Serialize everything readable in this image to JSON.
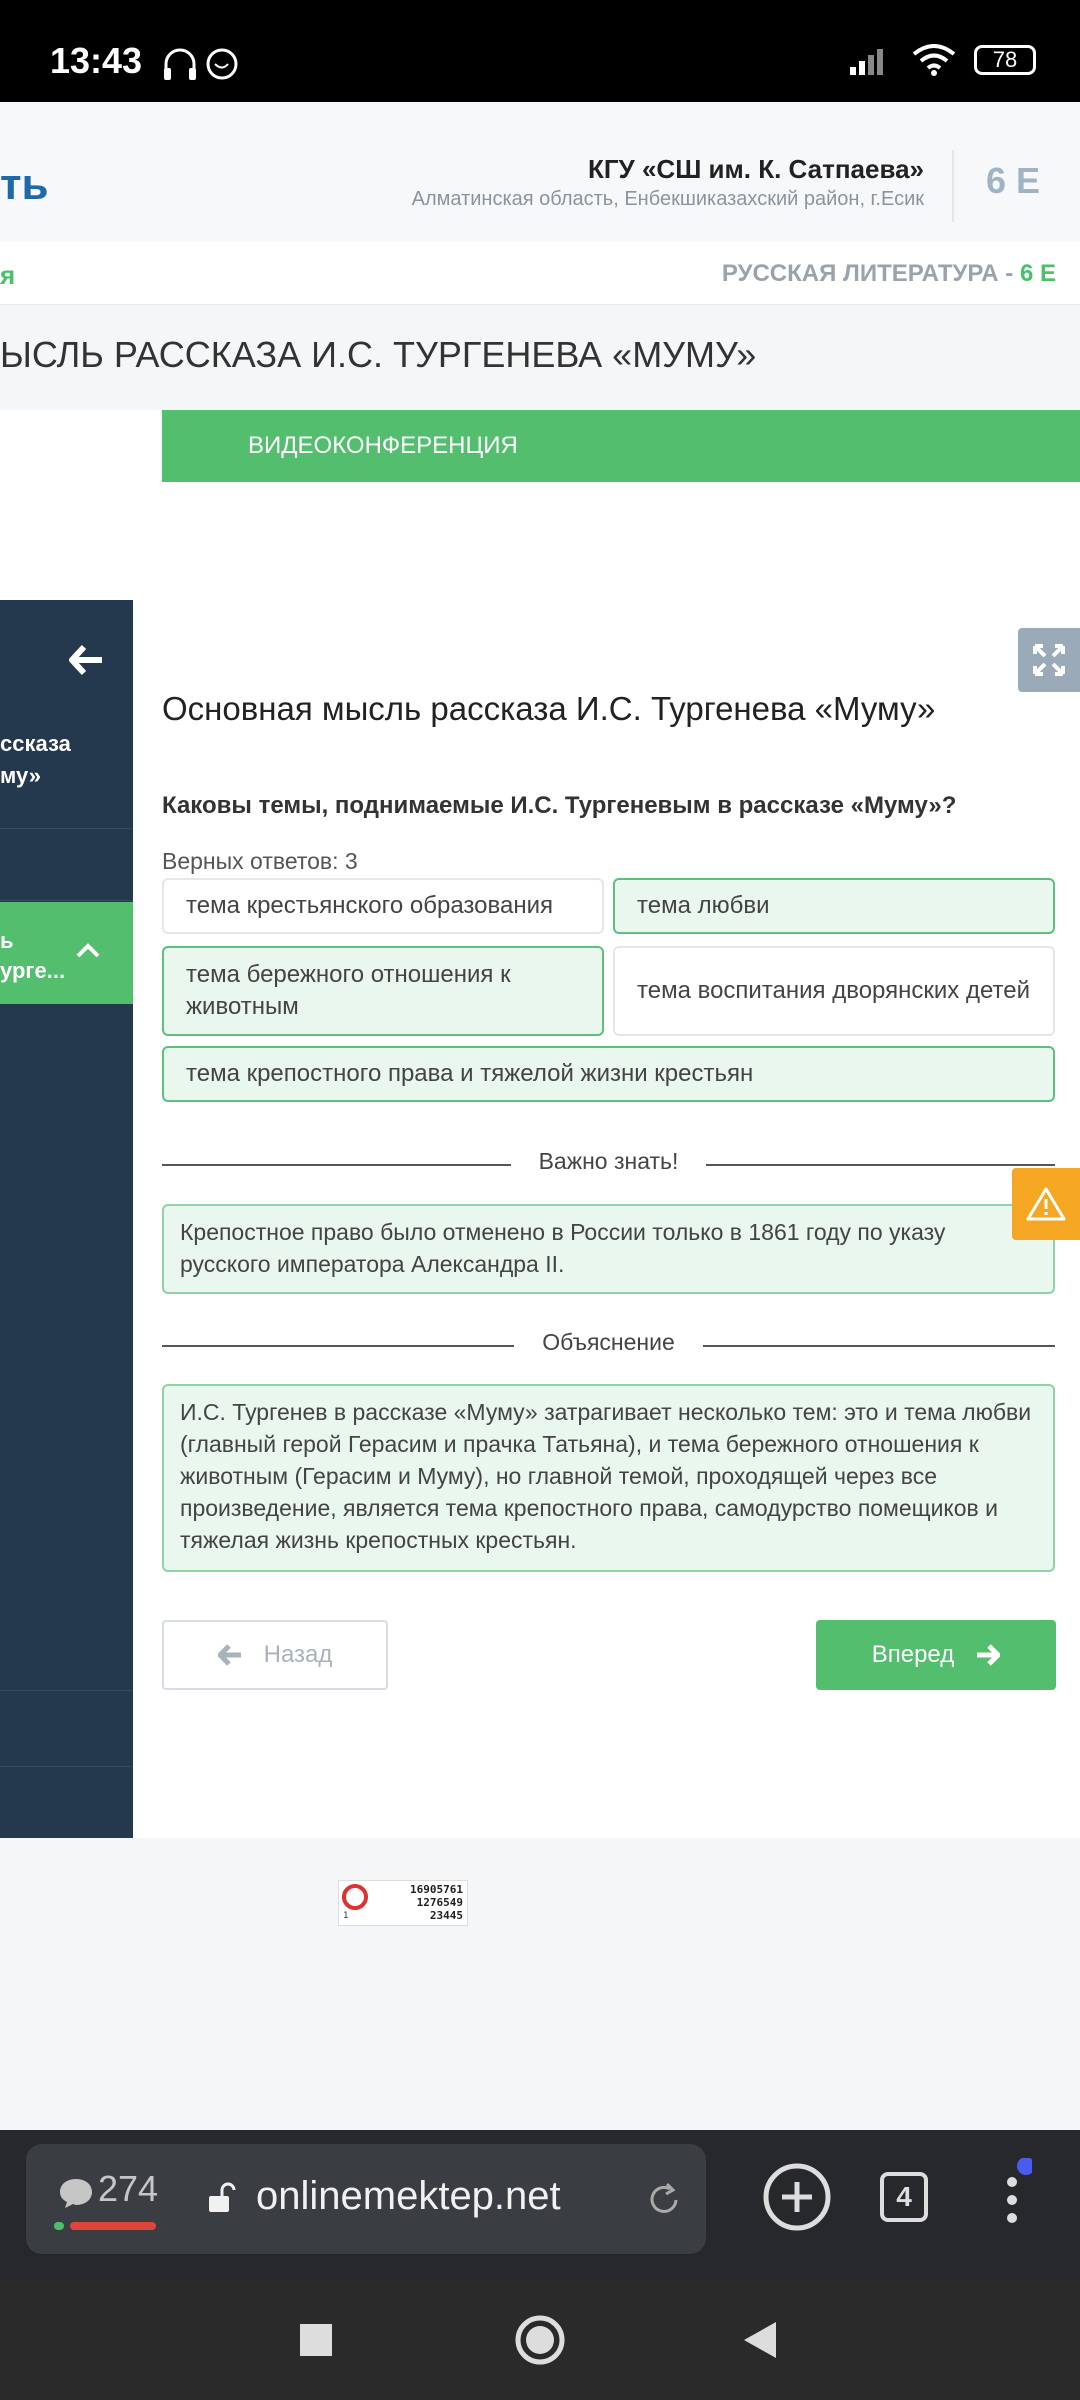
{
  "status_bar": {
    "time": "13:43",
    "battery": "78"
  },
  "header": {
    "logo_fragment": "ть",
    "school_name": "КГУ «СШ им. К. Сатпаева»",
    "school_region": "Алматинская область, Енбекшиказахский район, г.Есик",
    "class_badge": "6 Е"
  },
  "subject_bar": {
    "left_fragment": "я",
    "subject": "РУССКАЯ ЛИТЕРАТУРА - ",
    "grade": "6 Е"
  },
  "lesson_title": "ЫСЛЬ РАССКАЗА И.С. ТУРГЕНЕВА «МУМУ»",
  "tabs": {
    "videoconference": "ВИДЕОКОНФЕРЕНЦИЯ"
  },
  "sidebar": {
    "item1_line1": "ссказа",
    "item1_line2": "му»",
    "active_line1": "ь",
    "active_line2": "урге..."
  },
  "main": {
    "title": "Основная мысль рассказа И.С. Тургенева «Муму»",
    "question": "Каковы темы, поднимаемые И.С. Тургеневым в рассказе «Муму»?",
    "correct_count": "Верных ответов: 3",
    "options": [
      {
        "label": "тема крестьянского образования",
        "selected": false
      },
      {
        "label": "тема любви",
        "selected": true
      },
      {
        "label": "тема бережного отношения к животным",
        "selected": true
      },
      {
        "label": "тема воспитания дворянских детей",
        "selected": false
      },
      {
        "label": "тема крепостного права и тяжелой жизни крестьян",
        "selected": true
      }
    ],
    "important_label": "Важно знать!",
    "important_text": "Крепостное право было отменено в России только в 1861 году по указу русского императора Александра II.",
    "explanation_label": "Объяснение",
    "explanation_text": "И.С. Тургенев в рассказе «Муму» затрагивает несколько тем: это и тема любви (главный герой Герасим и прачка Татьяна), и тема бережного отношения к животным (Герасим и Муму), но главной темой, проходящей через все произведение, является тема крепостного права, самодурство помещиков и тяжелая жизнь крепостных крестьян.",
    "back_label": "Назад",
    "next_label": "Вперед"
  },
  "counter": {
    "line1": "16905761",
    "line2": "1276549",
    "line3": "23445",
    "small": "1"
  },
  "browser": {
    "chat_count": "274",
    "url": "onlinemektep.net",
    "tabs": "4"
  }
}
